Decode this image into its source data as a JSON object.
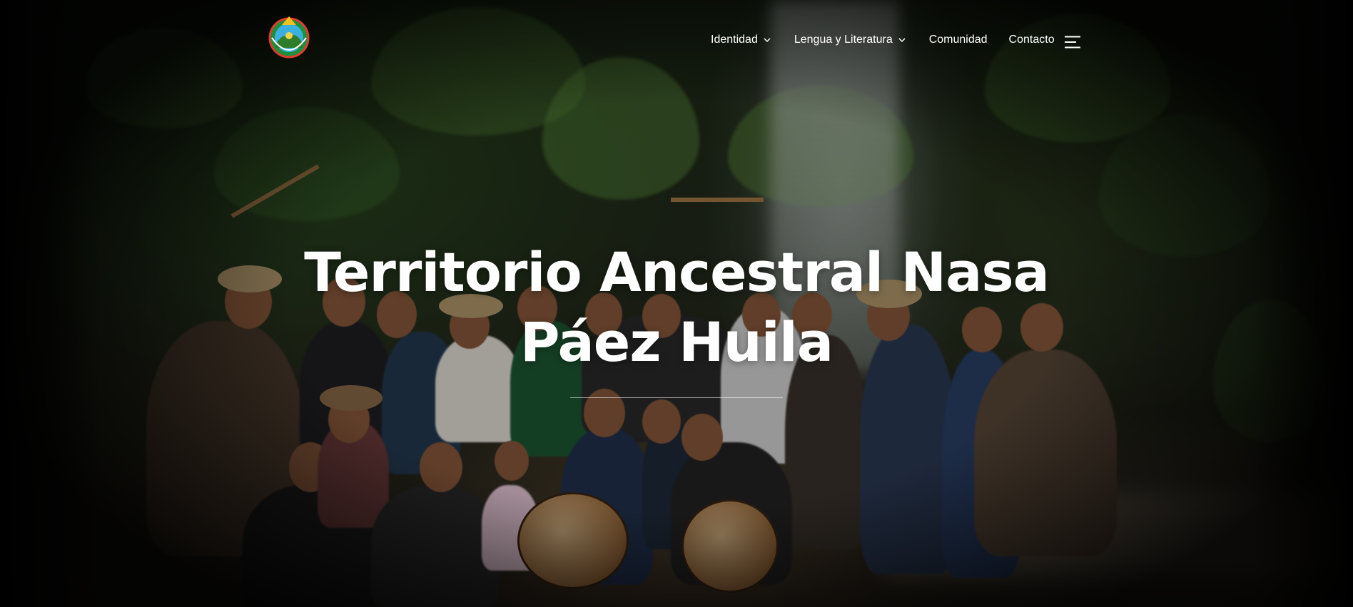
{
  "site": {
    "logo_icon": "nasa-community-emblem-icon"
  },
  "nav": {
    "items": [
      {
        "label": "Identidad",
        "has_dropdown": true
      },
      {
        "label": "Lengua y Literatura",
        "has_dropdown": true
      },
      {
        "label": "Comunidad",
        "has_dropdown": false
      },
      {
        "label": "Contacto",
        "has_dropdown": false
      }
    ],
    "menu_toggle_icon": "hamburger-menu-icon"
  },
  "hero": {
    "title_line1": "Territorio Ancestral Nasa",
    "title_line2": "Páez Huila",
    "background_image": "group-photo-community-waterfall"
  },
  "colors": {
    "text": "#ffffff",
    "overlay": "#000000"
  }
}
